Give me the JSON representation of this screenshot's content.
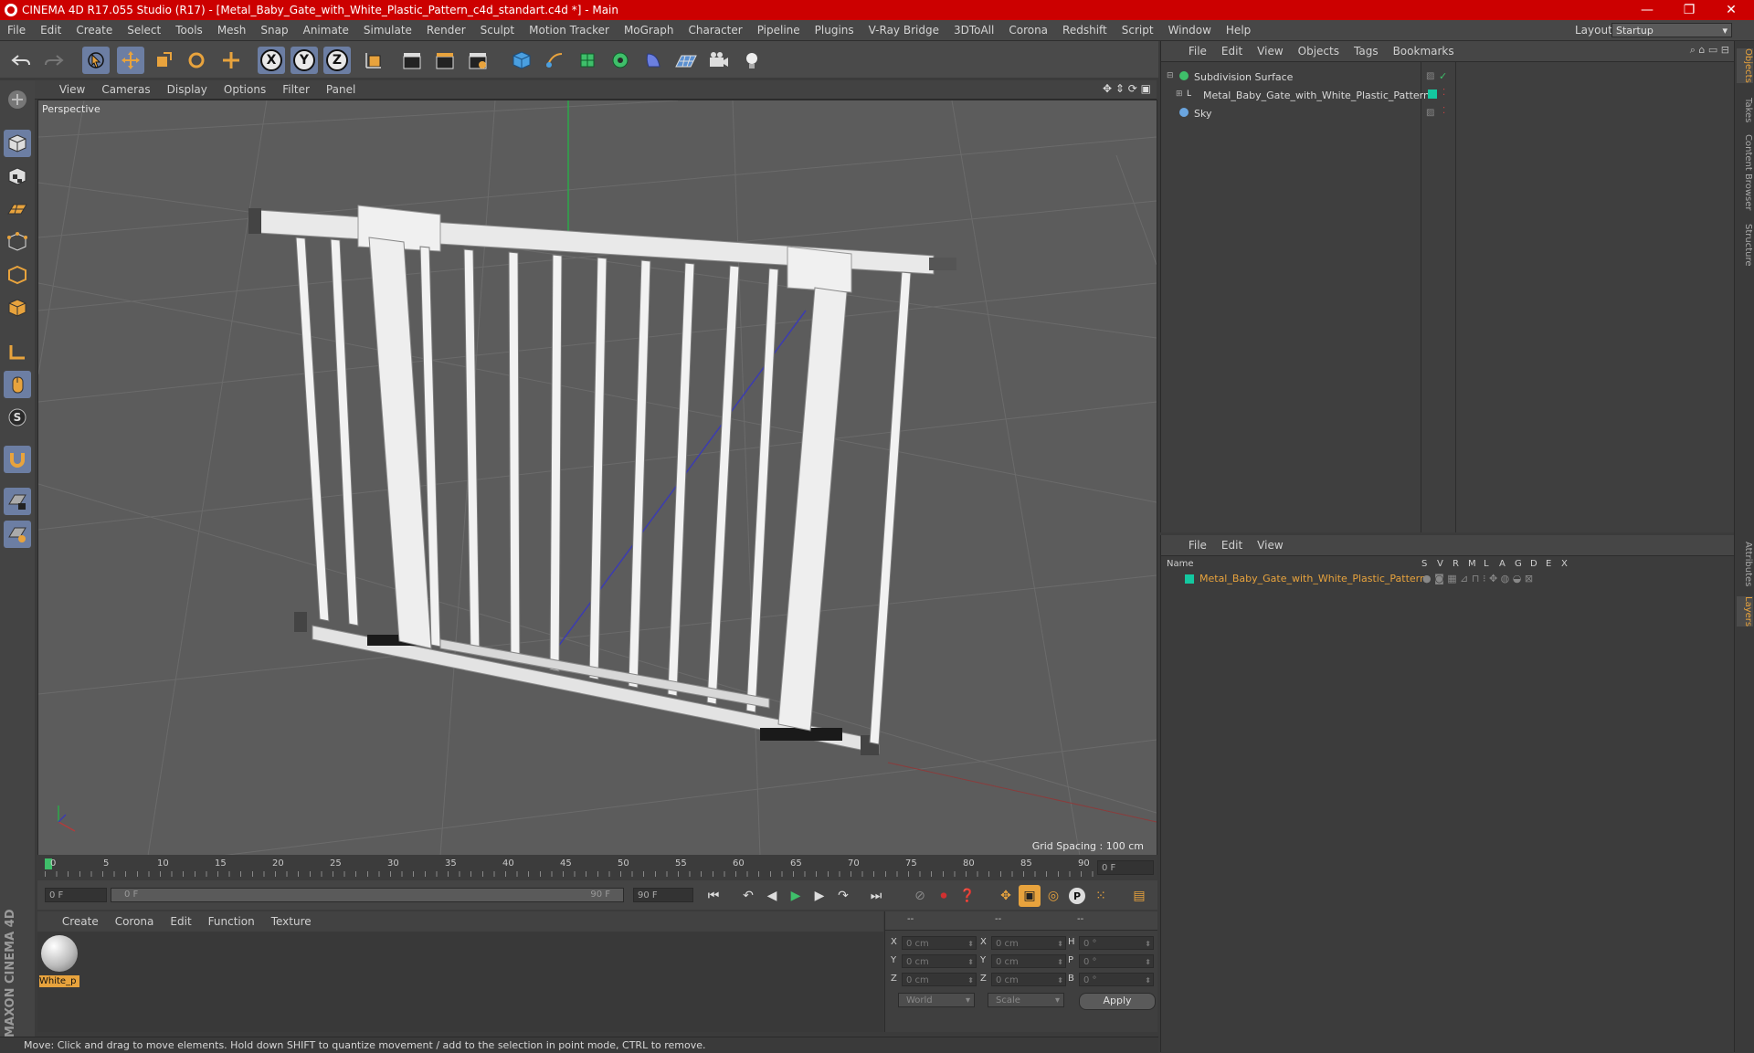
{
  "window": {
    "title": "CINEMA 4D R17.055 Studio (R17) - [Metal_Baby_Gate_with_White_Plastic_Pattern_c4d_standart.c4d *] - Main",
    "controls": {
      "minimize": "—",
      "maximize": "❐",
      "close": "✕"
    }
  },
  "menubar": {
    "items": [
      "File",
      "Edit",
      "Create",
      "Select",
      "Tools",
      "Mesh",
      "Snap",
      "Animate",
      "Simulate",
      "Render",
      "Sculpt",
      "Motion Tracker",
      "MoGraph",
      "Character",
      "Pipeline",
      "Plugins",
      "V-Ray Bridge",
      "3DToAll",
      "Corona",
      "Redshift",
      "Script",
      "Window",
      "Help"
    ],
    "layout_label": "Layout:",
    "layout_value": "Startup"
  },
  "toolbar": {
    "axes": [
      "X",
      "Y",
      "Z"
    ]
  },
  "viewport": {
    "menu": [
      "View",
      "Cameras",
      "Display",
      "Options",
      "Filter",
      "Panel"
    ],
    "label": "Perspective",
    "grid_spacing": "Grid Spacing : 100 cm"
  },
  "timeline": {
    "ticks": [
      "0",
      "5",
      "10",
      "15",
      "20",
      "25",
      "30",
      "35",
      "40",
      "45",
      "50",
      "55",
      "60",
      "65",
      "70",
      "75",
      "80",
      "85",
      "90"
    ],
    "current_frame": "0 F",
    "start_field": "0 F",
    "range_start": "0 F",
    "range_end": "90 F",
    "end_field": "90 F"
  },
  "materials": {
    "menu": [
      "Create",
      "Corona",
      "Edit",
      "Function",
      "Texture"
    ],
    "items": [
      {
        "label": "White_p"
      }
    ]
  },
  "coordinates": {
    "col_headers": [
      "--",
      "--",
      "--"
    ],
    "rows": [
      {
        "a": "X",
        "a_val": "0 cm",
        "b": "X",
        "b_val": "0 cm",
        "c": "H",
        "c_val": "0 °"
      },
      {
        "a": "Y",
        "a_val": "0 cm",
        "b": "Y",
        "b_val": "0 cm",
        "c": "P",
        "c_val": "0 °"
      },
      {
        "a": "Z",
        "a_val": "0 cm",
        "b": "Z",
        "b_val": "0 cm",
        "c": "B",
        "c_val": "0 °"
      }
    ],
    "mode": "World",
    "transform": "Scale",
    "apply": "Apply"
  },
  "status": "Move: Click and drag to move elements. Hold down SHIFT to quantize movement / add to the selection in point mode, CTRL to remove.",
  "objects_panel": {
    "menu": [
      "File",
      "Edit",
      "View",
      "Objects",
      "Tags",
      "Bookmarks"
    ],
    "objects": [
      {
        "name": "Subdivision Surface"
      },
      {
        "name": "Metal_Baby_Gate_with_White_Plastic_Pattern"
      },
      {
        "name": "Sky"
      }
    ]
  },
  "layers_panel": {
    "menu": [
      "File",
      "Edit",
      "View"
    ],
    "name_header": "Name",
    "columns": [
      "S",
      "V",
      "R",
      "M",
      "L",
      "A",
      "G",
      "D",
      "E",
      "X"
    ],
    "layers": [
      {
        "name": "Metal_Baby_Gate_with_White_Plastic_Pattern",
        "color": "#14c8a0"
      }
    ]
  },
  "side_tabs": [
    "Objects",
    "Takes",
    "Content Browser",
    "Structure",
    "Attributes",
    "Layers"
  ],
  "branding": "MAXON CINEMA 4D",
  "colors": {
    "accent": "#e8a33d",
    "title_bar": "#cc0000",
    "active_tool": "#6c7ea3",
    "layer": "#14c8a0"
  }
}
